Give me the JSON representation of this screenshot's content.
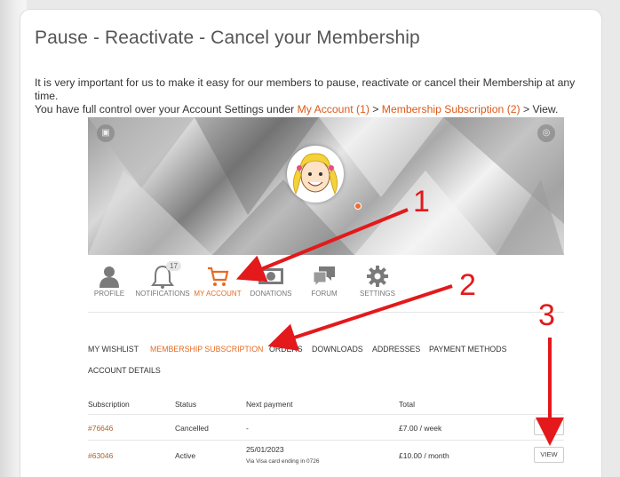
{
  "title": "Pause - Reactivate - Cancel your Membership",
  "intro": {
    "line1": "It is very important for us to make it easy for our members to pause, reactivate or cancel their Membership at any time.",
    "line2_prefix": "You have full control over your Account Settings under ",
    "link_my_account": "My Account (1)",
    "sep": " > ",
    "link_membership": "Membership Subscription (2)",
    "line2_suffix": " > View."
  },
  "nav": {
    "items": [
      {
        "label": "PROFILE",
        "icon": "person-icon"
      },
      {
        "label": "NOTIFICATIONS",
        "icon": "bell-icon",
        "badge": "17"
      },
      {
        "label": "MY ACCOUNT",
        "icon": "cart-icon"
      },
      {
        "label": "DONATIONS",
        "icon": "money-icon"
      },
      {
        "label": "FORUM",
        "icon": "chat-icon"
      },
      {
        "label": "SETTINGS",
        "icon": "gear-icon"
      }
    ]
  },
  "tabs": [
    "MY WISHLIST",
    "MEMBERSHIP SUBSCRIPTION",
    "ORDERS",
    "DOWNLOADS",
    "ADDRESSES",
    "PAYMENT METHODS",
    "ACCOUNT DETAILS"
  ],
  "table": {
    "headers": [
      "Subscription",
      "Status",
      "Next payment",
      "Total"
    ],
    "rows": [
      {
        "id": "#76646",
        "status": "Cancelled",
        "next": "-",
        "next_note": "",
        "total": "£7.00 / week"
      },
      {
        "id": "#63046",
        "status": "Active",
        "next": "25/01/2023",
        "next_note": "Via Visa card ending in 0726",
        "total": "£10.00 / month",
        "action": "VIEW"
      }
    ]
  },
  "annotations": [
    "1",
    "2",
    "3"
  ],
  "colors": {
    "accent": "#e86a22",
    "arrow": "#e3191b"
  }
}
